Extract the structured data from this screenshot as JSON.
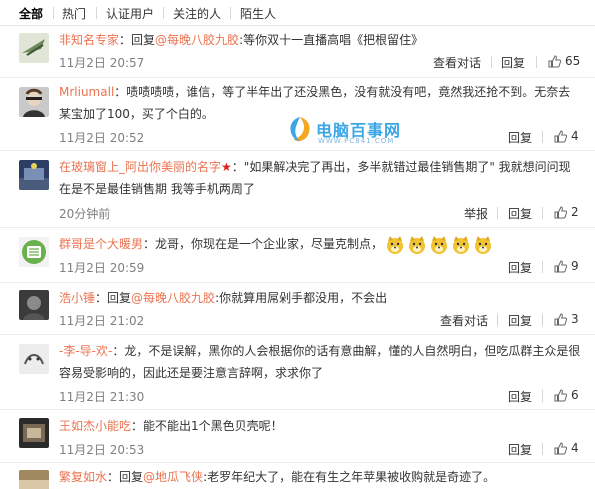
{
  "tabs": [
    "全部",
    "热门",
    "认证用户",
    "关注的人",
    "陌生人"
  ],
  "watermark": {
    "text": "电脑百事网",
    "sub": "WWW.PC841.COM"
  },
  "comments": [
    {
      "user": "非知名专家",
      "colon": "：",
      "reply_prefix": "回复",
      "mention": "@每晚八胶九胶",
      "text": ":等你双十一直播高唱《把根留住》",
      "time": "11月2日 20:57",
      "view": "查看对话",
      "reply": "回复",
      "likes": "65"
    },
    {
      "user": "Mrliumall",
      "colon": "：",
      "text": "啧啧啧啧，谁信，等了半年出了还没黑色，没有就没有吧，竟然我还抢不到。无奈去某宝加了100，买了个白的。",
      "time": "11月2日 20:52",
      "reply": "回复",
      "likes": "4"
    },
    {
      "user": "在玻璃窗上_阿出你美丽的名字",
      "star": "★",
      "colon": "：",
      "text": "\"如果解决完了再出，多半就错过最佳销售期了\" 我就想问问现在是不是最佳销售期 我等手机两周了",
      "time": "20分钟前",
      "report": "举报",
      "reply": "回复",
      "likes": "2"
    },
    {
      "user": "群哥是个大暖男",
      "colon": "：",
      "text": "龙哥，你现在是一个企业家，尽量克制点，",
      "time": "11月2日 20:59",
      "reply": "回复",
      "likes": "9"
    },
    {
      "user": "浩小锤",
      "colon": "：",
      "reply_prefix": "回复",
      "mention": "@每晚八胶九胶",
      "text": ":你就算用屌剁手都没用，不会出",
      "time": "11月2日 21:02",
      "view": "查看对话",
      "reply": "回复",
      "likes": "3"
    },
    {
      "user": "-李-导-欢-",
      "colon": "：",
      "text": "龙，不是误解，黑你的人会根据你的话有意曲解，懂的人自然明白，但吃瓜群主众是很容易受影响的，因此还是要注意言辞啊，求求你了",
      "time": "11月2日 21:30",
      "reply": "回复",
      "likes": "6"
    },
    {
      "user": "王如杰小能吃",
      "colon": "：",
      "text": "能不能出1个黑色贝壳呢！",
      "time": "11月2日 20:53",
      "reply": "回复",
      "likes": "4"
    },
    {
      "user": "繁复如水",
      "colon": "：",
      "reply_prefix": "回复",
      "mention": "@地瓜飞侠",
      "text": ":老罗年纪大了，能在有生之年苹果被收购就是奇迹了。"
    }
  ]
}
